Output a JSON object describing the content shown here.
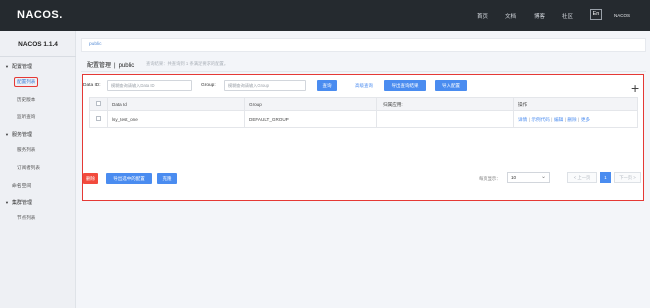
{
  "topbar": {
    "logo": "NACOS.",
    "nav": [
      "首页",
      "文档",
      "博客",
      "社区"
    ],
    "lang": "En",
    "brand": "NACOS"
  },
  "sidebar": {
    "version": "NACOS 1.1.4",
    "groups": [
      {
        "label": "配置管理",
        "items": [
          "配置列表",
          "历史版本",
          "监听查询"
        ]
      },
      {
        "label": "服务管理",
        "items": [
          "服务列表",
          "订阅者列表"
        ]
      },
      {
        "label": "命名空间",
        "items": []
      },
      {
        "label": "集群管理",
        "items": [
          "节点列表"
        ]
      }
    ]
  },
  "breadcrumb": "public",
  "page": {
    "title": "配置管理",
    "namespace": "public",
    "hint": "查询结果：共查询到 1 条满足要求的配置。"
  },
  "search": {
    "dataid_label": "Data ID:",
    "dataid_placeholder": "模糊查询请输入Data ID",
    "group_label": "Group:",
    "group_placeholder": "模糊查询请输入Group",
    "query_btn": "查询",
    "advanced": "高级查询",
    "export_btn": "导出查询结果",
    "import_btn": "导入配置"
  },
  "table": {
    "headers": [
      "Data Id",
      "Group",
      "归属应用:",
      "操作"
    ],
    "rows": [
      {
        "dataid": "lsy_test_one",
        "group": "DEFAULT_GROUP",
        "app": "",
        "ops": [
          "详情",
          "示例代码",
          "编辑",
          "删除",
          "更多"
        ]
      }
    ]
  },
  "footer": {
    "delete_btn": "删除",
    "export_selected_btn": "导出选中的配置",
    "clone_btn": "克隆",
    "page_size_label": "每页显示：",
    "page_size": "10",
    "prev": "< 上一页",
    "current_page": "1",
    "next": "下一页 >"
  },
  "colors": {
    "accent": "#4a8cf0",
    "danger": "#f24a3d",
    "topbar": "#252a2f",
    "highlight": "#e53935"
  }
}
